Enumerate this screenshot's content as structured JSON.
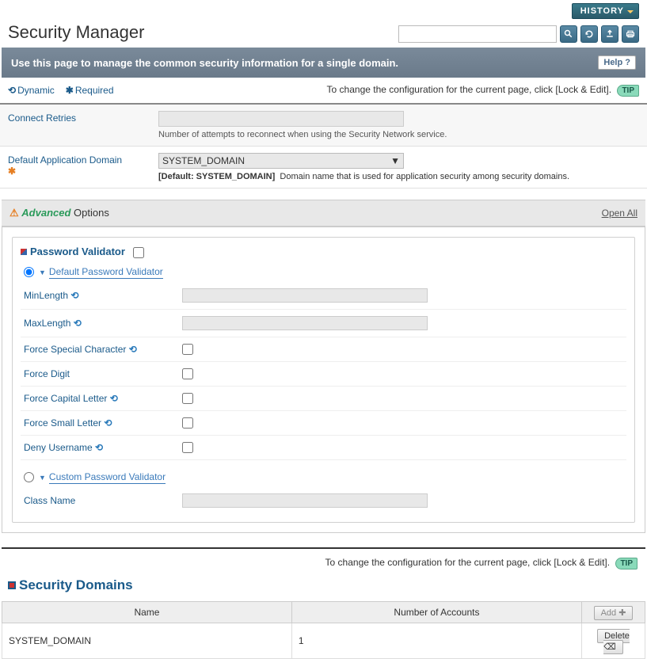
{
  "top": {
    "history": "HISTORY"
  },
  "title": "Security Manager",
  "banner": {
    "text": "Use this page to manage the common security information for a single domain.",
    "help": "Help ?"
  },
  "legend": {
    "dynamic": "Dynamic",
    "required": "Required"
  },
  "tip": {
    "text": "To change the configuration for the current page, click [Lock & Edit].",
    "badge": "TIP"
  },
  "fields": {
    "connect_retries": {
      "label": "Connect Retries",
      "desc": "Number of attempts to reconnect when using the Security Network service."
    },
    "default_domain": {
      "label": "Default Application Domain",
      "value": "SYSTEM_DOMAIN",
      "default_prefix": "[Default: SYSTEM_DOMAIN]",
      "desc": "Domain name that is used for application security among security domains."
    }
  },
  "advanced": {
    "label_em": "Advanced",
    "label_rest": " Options",
    "open_all": "Open All"
  },
  "pv": {
    "title": "Password Validator",
    "default_radio": "Default Password Validator",
    "custom_radio": "Custom Password Validator",
    "minlength": "MinLength",
    "maxlength": "MaxLength",
    "force_special": "Force Special Character",
    "force_digit": "Force Digit",
    "force_capital": "Force Capital Letter",
    "force_small": "Force Small Letter",
    "deny_user": "Deny Username",
    "class_name": "Class Name"
  },
  "domains": {
    "title": "Security Domains",
    "col_name": "Name",
    "col_accounts": "Number of Accounts",
    "add": "Add",
    "delete": "Delete",
    "rows": [
      {
        "name": "SYSTEM_DOMAIN",
        "accounts": "1"
      }
    ]
  }
}
